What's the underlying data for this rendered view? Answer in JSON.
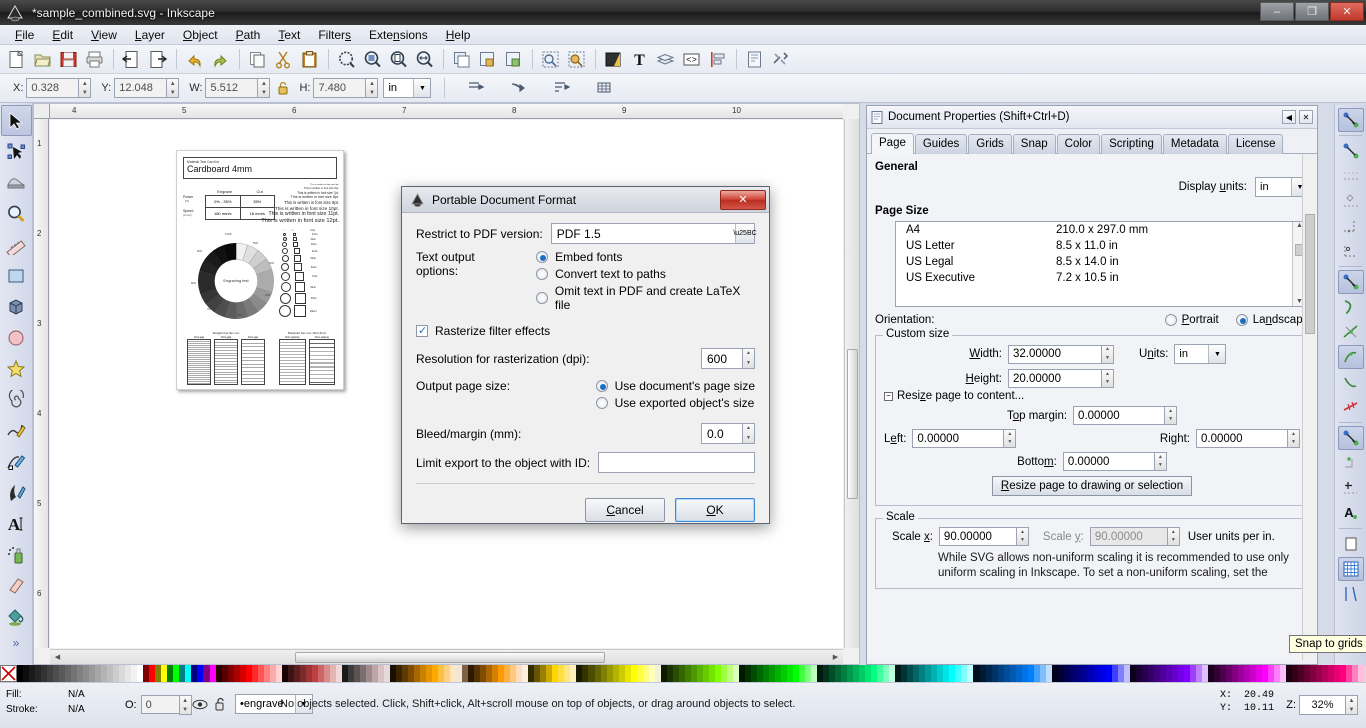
{
  "window": {
    "title": "*sample_combined.svg - Inkscape",
    "buttons": {
      "minimize": "–",
      "restore": "❐",
      "close": "✕"
    }
  },
  "menubar": {
    "items": [
      {
        "label": "File",
        "accel": "F"
      },
      {
        "label": "Edit",
        "accel": "E"
      },
      {
        "label": "View",
        "accel": "V"
      },
      {
        "label": "Layer",
        "accel": "L"
      },
      {
        "label": "Object",
        "accel": "O"
      },
      {
        "label": "Path",
        "accel": "P"
      },
      {
        "label": "Text",
        "accel": "T"
      },
      {
        "label": "Filters",
        "accel": "s"
      },
      {
        "label": "Extensions",
        "accel": "n"
      },
      {
        "label": "Help",
        "accel": "H"
      }
    ]
  },
  "command_toolbar": {
    "icons": [
      "new-document-icon",
      "open-document-icon",
      "save-document-icon",
      "print-icon",
      "import-icon",
      "export-icon",
      "undo-icon",
      "redo-icon",
      "copy-icon",
      "cut-icon",
      "paste-icon",
      "zoom-selection-icon",
      "zoom-drawing-icon",
      "zoom-page-icon",
      "zoom-page-width-icon",
      "duplicate-icon",
      "group-icon",
      "ungroup-icon",
      "fill-stroke-dialog-icon",
      "object-properties-icon",
      "fill-stroke-icon",
      "text-tool-icon",
      "layers-icon",
      "xml-editor-icon",
      "align-distribute-icon",
      "document-properties-icon",
      "preferences-icon"
    ]
  },
  "options_toolbar": {
    "fields": [
      {
        "name": "x",
        "label": "X:",
        "value": "0.328"
      },
      {
        "name": "y",
        "label": "Y:",
        "value": "12.048"
      },
      {
        "name": "w",
        "label": "W:",
        "value": "5.512"
      },
      {
        "name": "h",
        "label": "H:",
        "value": "7.480"
      }
    ],
    "lock_icon": "lock-ratio-icon",
    "units": "in",
    "extra_icons": [
      "affect-stroke-icon",
      "affect-corners-icon",
      "affect-gradients-icon",
      "affect-patterns-icon"
    ]
  },
  "toolbox": {
    "tools": [
      {
        "name": "selector-tool",
        "icon": "arrow-select-icon",
        "selected": true
      },
      {
        "name": "node-tool",
        "icon": "node-edit-icon",
        "selected": false
      },
      {
        "name": "tweak-tool",
        "icon": "tweak-icon",
        "selected": false
      },
      {
        "name": "zoom-tool",
        "icon": "magnifier-icon",
        "selected": false
      },
      {
        "name": "measure-tool",
        "icon": "ruler-icon",
        "selected": false
      },
      {
        "name": "rectangle-tool",
        "icon": "rectangle-icon",
        "selected": false
      },
      {
        "name": "box3d-tool",
        "icon": "cube-icon",
        "selected": false
      },
      {
        "name": "ellipse-tool",
        "icon": "circle-icon",
        "selected": false
      },
      {
        "name": "star-tool",
        "icon": "star-icon",
        "selected": false
      },
      {
        "name": "spiral-tool",
        "icon": "spiral-icon",
        "selected": false
      },
      {
        "name": "pencil-tool",
        "icon": "pencil-icon",
        "selected": false
      },
      {
        "name": "bezier-tool",
        "icon": "bezier-pen-icon",
        "selected": false
      },
      {
        "name": "calligraphy-tool",
        "icon": "calligraphy-icon",
        "selected": false
      },
      {
        "name": "text-tool",
        "icon": "letter-a-icon",
        "selected": false
      },
      {
        "name": "spray-tool",
        "icon": "spray-can-icon",
        "selected": false
      },
      {
        "name": "eraser-tool",
        "icon": "eraser-icon",
        "selected": false
      },
      {
        "name": "paint-bucket-tool",
        "icon": "paint-bucket-icon",
        "selected": false
      }
    ],
    "overflow_label": "»"
  },
  "canvas": {
    "ruler_units": "in",
    "h_ruler_ticks": [
      "4",
      "5",
      "6",
      "7",
      "8",
      "9",
      "10"
    ],
    "v_ruler_ticks": [
      "1",
      "2",
      "3",
      "4",
      "5",
      "6"
    ],
    "drawing": {
      "header_small": "Material Test Card for",
      "header_title": "Cardboard 4mm",
      "table_headers": [
        "Engrave",
        "Cut"
      ],
      "table_rows": [
        {
          "label": "Power",
          "unit": "[%]",
          "engrave": "0% - 35%",
          "cut": "35%"
        },
        {
          "label": "Speed",
          "unit": "[mm/s]",
          "engrave": "180 mm/s",
          "cut": "18 mm/s"
        }
      ],
      "font_samples": [
        "This is written in font size 5pt.",
        "This is written in font size 6pt.",
        "This is written in font size 7pt.",
        "This is written in font size 8pt.",
        "This is written in font size 9pt.",
        "This is written in font size 10pt.",
        "This is written in font size 11pt.",
        "This is written in font size 12pt."
      ],
      "wheel_center_label": "Engraving test",
      "wheel_labels": [
        "100%",
        "95%",
        "90%",
        "85%",
        "80%",
        "75%",
        "70%",
        "65%",
        "60%",
        "55%",
        "50%",
        "45%",
        "40%",
        "35%",
        "30%",
        "25%",
        "20%",
        "15%",
        "10%",
        "5%"
      ],
      "shape_col_headers": [
        "○",
        "□",
        "Size"
      ],
      "shape_sizes": [
        "1mm",
        "2mm",
        "3mm",
        "4mm",
        "5mm",
        "6mm",
        "7mm",
        "8mm",
        "9mm",
        "10mm"
      ],
      "flex_left_title": "Straight line flex cut:",
      "flex_left_cols": [
        "2mm-gap",
        "3mm-gap",
        "4mm-gap"
      ],
      "flex_right_title": "Parabolic flex cut: 16x1,5mm",
      "flex_right_cols": [
        "3mm spacing",
        "4mm spacing"
      ]
    }
  },
  "export_dialog": {
    "title": "Portable Document Format",
    "icon": "inkscape-logo-icon",
    "close_label": "✕",
    "pdf_version_label": "Restrict to PDF version:",
    "pdf_version_value": "PDF 1.5",
    "text_output_label": "Text output options:",
    "text_options": [
      {
        "label": "Embed fonts",
        "selected": true
      },
      {
        "label": "Convert text to paths",
        "selected": false
      },
      {
        "label": "Omit text in PDF and create LaTeX file",
        "selected": false
      }
    ],
    "rasterize_label": "Rasterize filter effects",
    "rasterize_checked": true,
    "resolution_label": "Resolution for rasterization (dpi):",
    "resolution_value": "600",
    "output_page_size_label": "Output page size:",
    "page_size_options": [
      {
        "label": "Use document's page size",
        "selected": true
      },
      {
        "label": "Use exported object's size",
        "selected": false
      }
    ],
    "bleed_label": "Bleed/margin (mm):",
    "bleed_value": "0.0",
    "limit_export_label": "Limit export to the object with ID:",
    "limit_export_value": "",
    "cancel_label": "Cancel",
    "ok_label": "OK"
  },
  "document_properties": {
    "title": "Document Properties (Shift+Ctrl+D)",
    "icon": "document-properties-icon",
    "collapse_icon": "collapse-icon",
    "close_icon": "close-icon",
    "tabs": [
      {
        "label": "Page",
        "active": true
      },
      {
        "label": "Guides",
        "active": false
      },
      {
        "label": "Grids",
        "active": false
      },
      {
        "label": "Snap",
        "active": false
      },
      {
        "label": "Color",
        "active": false
      },
      {
        "label": "Scripting",
        "active": false
      },
      {
        "label": "Metadata",
        "active": false
      },
      {
        "label": "License",
        "active": false
      }
    ],
    "general_label": "General",
    "display_units_label": "Display units:",
    "display_units_value": "in",
    "page_size_label": "Page Size",
    "page_sizes": [
      {
        "name": "A4",
        "dims": "210.0 x 297.0 mm"
      },
      {
        "name": "US Letter",
        "dims": "8.5 x 11.0 in"
      },
      {
        "name": "US Legal",
        "dims": "8.5 x 14.0 in"
      },
      {
        "name": "US Executive",
        "dims": "7.2 x 10.5 in"
      }
    ],
    "orientation_label": "Orientation:",
    "orientation_options": [
      {
        "label": "Portrait",
        "accel": "P",
        "selected": false
      },
      {
        "label": "Landscape",
        "accel": "n",
        "selected": true
      }
    ],
    "custom_size_legend": "Custom size",
    "width_label": "Width:",
    "width_value": "32.00000",
    "height_label": "Height:",
    "height_value": "20.00000",
    "units_label": "Units:",
    "units_value": "in",
    "resize_expander_label": "Resize page to content...",
    "top_margin_label": "Top margin:",
    "top_margin_value": "0.00000",
    "left_label": "Left:",
    "left_value": "0.00000",
    "right_label": "Right:",
    "right_value": "0.00000",
    "bottom_label": "Bottom:",
    "bottom_value": "0.00000",
    "resize_button_label": "Resize page to drawing or selection",
    "scale_legend": "Scale",
    "scale_x_label": "Scale x:",
    "scale_x_value": "90.00000",
    "scale_y_label": "Scale y:",
    "scale_y_value": "90.00000",
    "user_units_label": "User units per in.",
    "scale_note": "While SVG allows non-uniform scaling it is recommended to use only uniform scaling in Inkscape. To set a non-uniform scaling, set the"
  },
  "snap_toolbar": {
    "buttons": [
      {
        "name": "snap-enable-global",
        "icon": "snap-global-icon",
        "active": true
      },
      {
        "name": "snap-bounding-box",
        "icon": "snap-bbox-icon",
        "active": false
      },
      {
        "name": "snap-bbox-edge",
        "icon": "snap-bbox-edge-icon",
        "active": false
      },
      {
        "name": "snap-bbox-corner",
        "icon": "snap-bbox-corner-icon",
        "active": false
      },
      {
        "name": "snap-bbox-edge-midpoint",
        "icon": "snap-bbox-midpoint-icon",
        "active": false
      },
      {
        "name": "snap-bbox-center",
        "icon": "snap-bbox-center-icon",
        "active": false
      },
      {
        "name": "snap-nodes-paths",
        "icon": "snap-nodes-icon",
        "active": true
      },
      {
        "name": "snap-path",
        "icon": "snap-path-icon",
        "active": false
      },
      {
        "name": "snap-path-intersection",
        "icon": "snap-intersection-icon",
        "active": false
      },
      {
        "name": "snap-cusp-node",
        "icon": "snap-cusp-icon",
        "active": true
      },
      {
        "name": "snap-smooth-node",
        "icon": "snap-smooth-icon",
        "active": false
      },
      {
        "name": "snap-midpoint-line",
        "icon": "snap-line-midpoint-icon",
        "active": false
      },
      {
        "name": "snap-others",
        "icon": "snap-others-icon",
        "active": true
      },
      {
        "name": "snap-object-center",
        "icon": "snap-object-center-icon",
        "active": false
      },
      {
        "name": "snap-rotation-center",
        "icon": "snap-rotation-center-icon",
        "active": false
      },
      {
        "name": "snap-text-baseline",
        "icon": "snap-text-baseline-icon",
        "active": false
      },
      {
        "name": "snap-page-border",
        "icon": "snap-page-border-icon",
        "active": false
      },
      {
        "name": "snap-to-grids",
        "icon": "snap-grid-icon",
        "active": true
      },
      {
        "name": "snap-to-guides",
        "icon": "snap-guides-icon",
        "active": false
      }
    ]
  },
  "tooltip": {
    "text": "Snap to grids"
  },
  "statusbar": {
    "fill_label": "Fill:",
    "fill_value": "N/A",
    "stroke_label": "Stroke:",
    "stroke_value": "N/A",
    "opacity_label": "O:",
    "opacity_value": "0",
    "visibility_icon": "eye-icon",
    "lock_icon": "unlock-icon",
    "layer_value": "•engrave",
    "message": "No objects selected. Click, Shift+click, Alt+scroll mouse on top of objects, or drag around objects to select.",
    "x_label": "X:",
    "x_value": "20.49",
    "y_label": "Y:",
    "y_value": "10.11",
    "zoom_label": "Z:",
    "zoom_value": "32%"
  },
  "palette": {
    "none_swatch": "none-swatch",
    "colors": [
      "#000000",
      "#0d0d0d",
      "#1a1a1a",
      "#262626",
      "#333333",
      "#404040",
      "#4d4d4d",
      "#595959",
      "#666666",
      "#737373",
      "#808080",
      "#8c8c8c",
      "#999999",
      "#a6a6a6",
      "#b3b3b3",
      "#bfbfbf",
      "#cccccc",
      "#d9d9d9",
      "#e6e6e6",
      "#f2f2f2",
      "#ffffff",
      "#800000",
      "#ff0000",
      "#808000",
      "#ffff00",
      "#008000",
      "#00ff00",
      "#008080",
      "#00ffff",
      "#000080",
      "#0000ff",
      "#800080",
      "#ff00ff",
      "#2b0000",
      "#550000",
      "#800000",
      "#aa0000",
      "#d40000",
      "#ff0000",
      "#ff2a2a",
      "#ff5555",
      "#ff8080",
      "#ffaaaa",
      "#ffd5d5",
      "#1a0000",
      "#3c1414",
      "#5c1f1f",
      "#7d2a2a",
      "#9e3535",
      "#bf4040",
      "#cc6666",
      "#d98c8c",
      "#e6b3b3",
      "#f2d9d9",
      "#1a1a1a",
      "#3c3c3c",
      "#5c5252",
      "#7d6e6e",
      "#9e8a8a",
      "#bfa6a6",
      "#d9c3c3",
      "#e6dada",
      "#1a0f00",
      "#3c2400",
      "#5c3a00",
      "#804d00",
      "#a66600",
      "#cc8000",
      "#e69500",
      "#ffaa00",
      "#ffbf40",
      "#ffd180",
      "#ffe6bf",
      "#f2e6d9",
      "#806040",
      "#2b1a00",
      "#553300",
      "#804d00",
      "#aa6600",
      "#d48000",
      "#ff9900",
      "#ffb13f",
      "#ffc87f",
      "#ffdfbf",
      "#fff0e0",
      "#332b00",
      "#665500",
      "#998000",
      "#ccaa00",
      "#ffd500",
      "#ffdf40",
      "#ffe97f",
      "#fff2bf",
      "#1a1a00",
      "#333300",
      "#4d4d00",
      "#666600",
      "#808000",
      "#999900",
      "#b3b300",
      "#cccc00",
      "#e6e600",
      "#ffff00",
      "#ffff40",
      "#ffff80",
      "#ffffbf",
      "#f2f2d9",
      "#0d1a00",
      "#1a3300",
      "#264d00",
      "#336600",
      "#408000",
      "#4d9900",
      "#59b300",
      "#66cc00",
      "#73e600",
      "#80ff00",
      "#a0ff40",
      "#bfff80",
      "#dfffbf",
      "#001a00",
      "#003300",
      "#004d00",
      "#006600",
      "#008000",
      "#009900",
      "#00b300",
      "#00cc00",
      "#00e600",
      "#00ff00",
      "#40ff40",
      "#80ff80",
      "#bfffbf",
      "#001a0d",
      "#00331a",
      "#004d26",
      "#006633",
      "#008040",
      "#00994d",
      "#00b359",
      "#00cc66",
      "#00e673",
      "#00ff80",
      "#40ff9f",
      "#80ffbf",
      "#bfffdf",
      "#001a1a",
      "#003333",
      "#004d4d",
      "#006666",
      "#008080",
      "#009999",
      "#00b3b3",
      "#00cccc",
      "#00e6e6",
      "#00ffff",
      "#40ffff",
      "#80ffff",
      "#bfffff",
      "#000d1a",
      "#001a33",
      "#00264d",
      "#003366",
      "#004080",
      "#004d99",
      "#0059b3",
      "#0066cc",
      "#0073e6",
      "#0080ff",
      "#409fff",
      "#80bfff",
      "#bfdfff",
      "#00001a",
      "#000033",
      "#00004d",
      "#000066",
      "#000080",
      "#000099",
      "#0000b3",
      "#0000cc",
      "#0000e6",
      "#0000ff",
      "#4040ff",
      "#8080ff",
      "#bfbfff",
      "#0d001a",
      "#1a0033",
      "#26004d",
      "#330066",
      "#400080",
      "#4d0099",
      "#5900b3",
      "#6600cc",
      "#7300e6",
      "#8000ff",
      "#9f40ff",
      "#bf80ff",
      "#dfbfff",
      "#1a001a",
      "#330033",
      "#4d004d",
      "#660066",
      "#800080",
      "#990099",
      "#b300b3",
      "#cc00cc",
      "#e600e6",
      "#ff00ff",
      "#ff40ff",
      "#ff80ff",
      "#ffbfff",
      "#1a000d",
      "#33001a",
      "#4d0026",
      "#660033",
      "#800040",
      "#99004d",
      "#b30059",
      "#cc0066",
      "#e60073",
      "#ff0080",
      "#ff409f",
      "#ff80bf",
      "#ffbfdf"
    ]
  }
}
